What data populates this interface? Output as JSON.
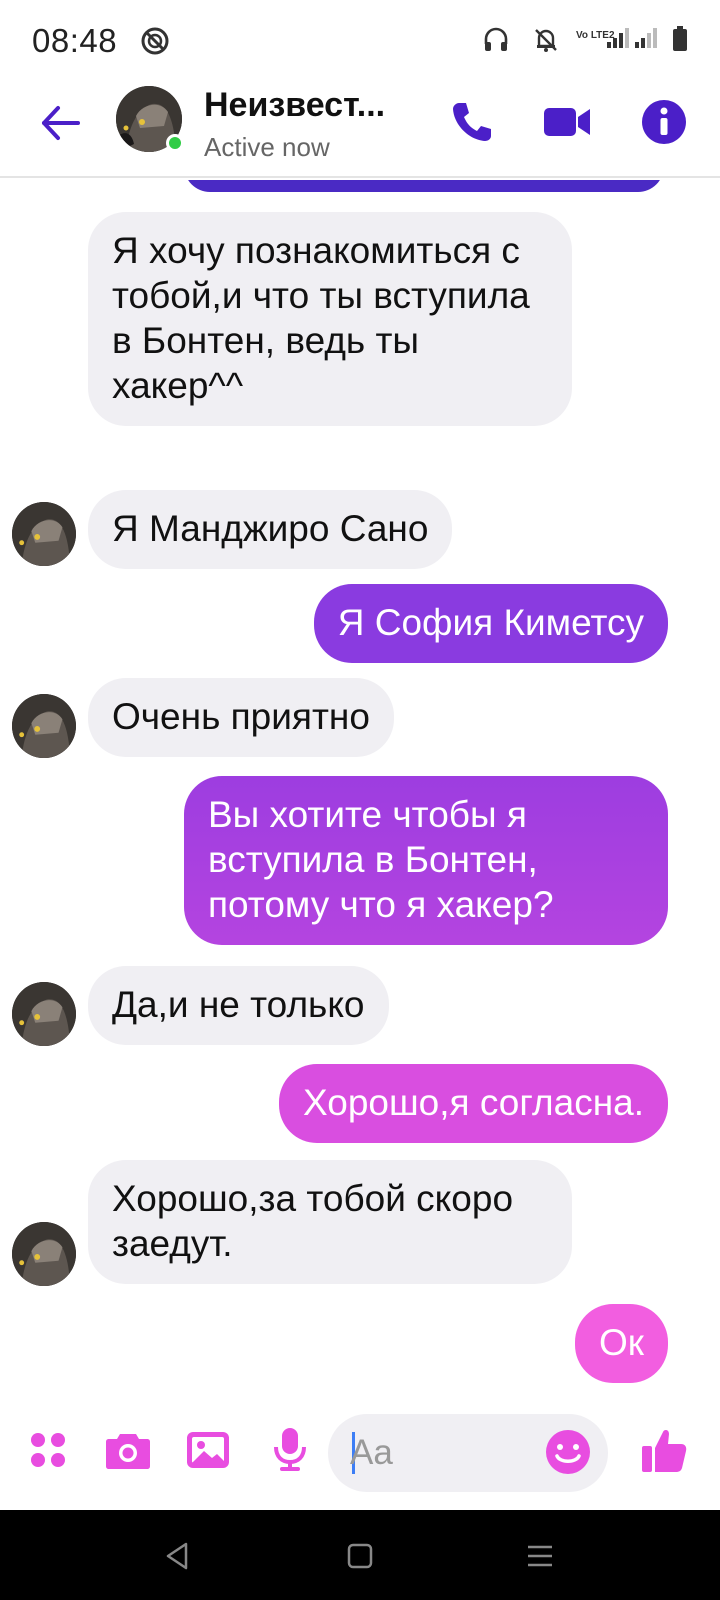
{
  "status_bar": {
    "time": "08:48",
    "icons": [
      "no-entry-icon",
      "headphones-icon",
      "bell-off-icon",
      "volte-icon",
      "signal-icon",
      "signal-icon",
      "battery-icon"
    ],
    "volte_label": "Vo LTE2"
  },
  "header": {
    "contact_name": "Неизвест...",
    "status": "Active now",
    "icons": [
      "back-arrow-icon",
      "phone-icon",
      "video-camera-icon",
      "info-icon"
    ],
    "accent_color": "#4b1fc8"
  },
  "messages": [
    {
      "direction": "incoming",
      "text": "Я хочу познакомиться с тобой,и что ты вступила в Бонтен, ведь ты хакер^^"
    },
    {
      "direction": "incoming",
      "text": "Я Манджиро Сано"
    },
    {
      "direction": "outgoing",
      "text": "Я София Киметсу",
      "color": "#8a3be0"
    },
    {
      "direction": "incoming",
      "text": "Очень приятно"
    },
    {
      "direction": "outgoing",
      "text": "Вы хотите чтобы я вступила в Бонтен, потому что я хакер?",
      "color": "#a642e0"
    },
    {
      "direction": "incoming",
      "text": "Да,и не только"
    },
    {
      "direction": "outgoing",
      "text": "Хорошо,я согласна.",
      "color": "#d94ee0"
    },
    {
      "direction": "incoming",
      "text": "Хорошо,за тобой скоро заедут."
    },
    {
      "direction": "outgoing",
      "text": "Ок",
      "color": "#f25ee0"
    }
  ],
  "composer": {
    "placeholder": "Aa",
    "icons": [
      "apps-dots-icon",
      "camera-icon",
      "image-icon",
      "microphone-icon",
      "emoji-icon",
      "thumbs-up-icon"
    ],
    "accent_color": "#e84de0"
  },
  "nav_bar": {
    "icons": [
      "back-triangle-icon",
      "home-square-icon",
      "menu-lines-icon"
    ]
  }
}
